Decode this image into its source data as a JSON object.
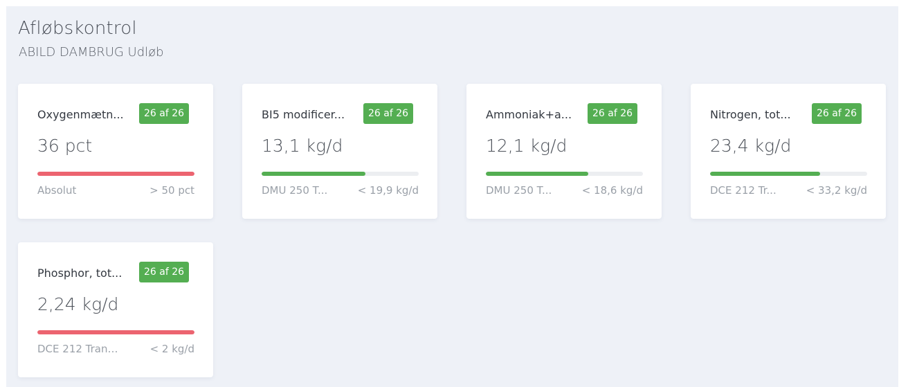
{
  "header": {
    "title": "Afløbskontrol",
    "subtitle": "ABILD DAMBRUG Udløb"
  },
  "colors": {
    "ok": "#54ae52",
    "bad": "#ec6470",
    "badge": "#54ae52"
  },
  "cards": [
    {
      "name": "Oxygenmætn...",
      "badge": "26 af 26",
      "value": "36 pct",
      "bar_fraction": 1.0,
      "status": "bad",
      "footer_left": "Absolut",
      "footer_right": "> 50 pct"
    },
    {
      "name": "BI5 modificer...",
      "badge": "26 af 26",
      "value": "13,1 kg/d",
      "bar_fraction": 0.66,
      "status": "ok",
      "footer_left": "DMU 250 T...",
      "footer_right": "< 19,9 kg/d"
    },
    {
      "name": "Ammoniak+a...",
      "badge": "26 af 26",
      "value": "12,1 kg/d",
      "bar_fraction": 0.65,
      "status": "ok",
      "footer_left": "DMU 250 T...",
      "footer_right": "< 18,6 kg/d"
    },
    {
      "name": "Nitrogen, tot...",
      "badge": "26 af 26",
      "value": "23,4 kg/d",
      "bar_fraction": 0.7,
      "status": "ok",
      "footer_left": "DCE 212 Tr...",
      "footer_right": "< 33,2 kg/d"
    },
    {
      "name": "Phosphor, tot...",
      "badge": "26 af 26",
      "value": "2,24 kg/d",
      "bar_fraction": 1.0,
      "status": "bad",
      "footer_left": "DCE 212 Trans...",
      "footer_right": "< 2 kg/d"
    }
  ]
}
